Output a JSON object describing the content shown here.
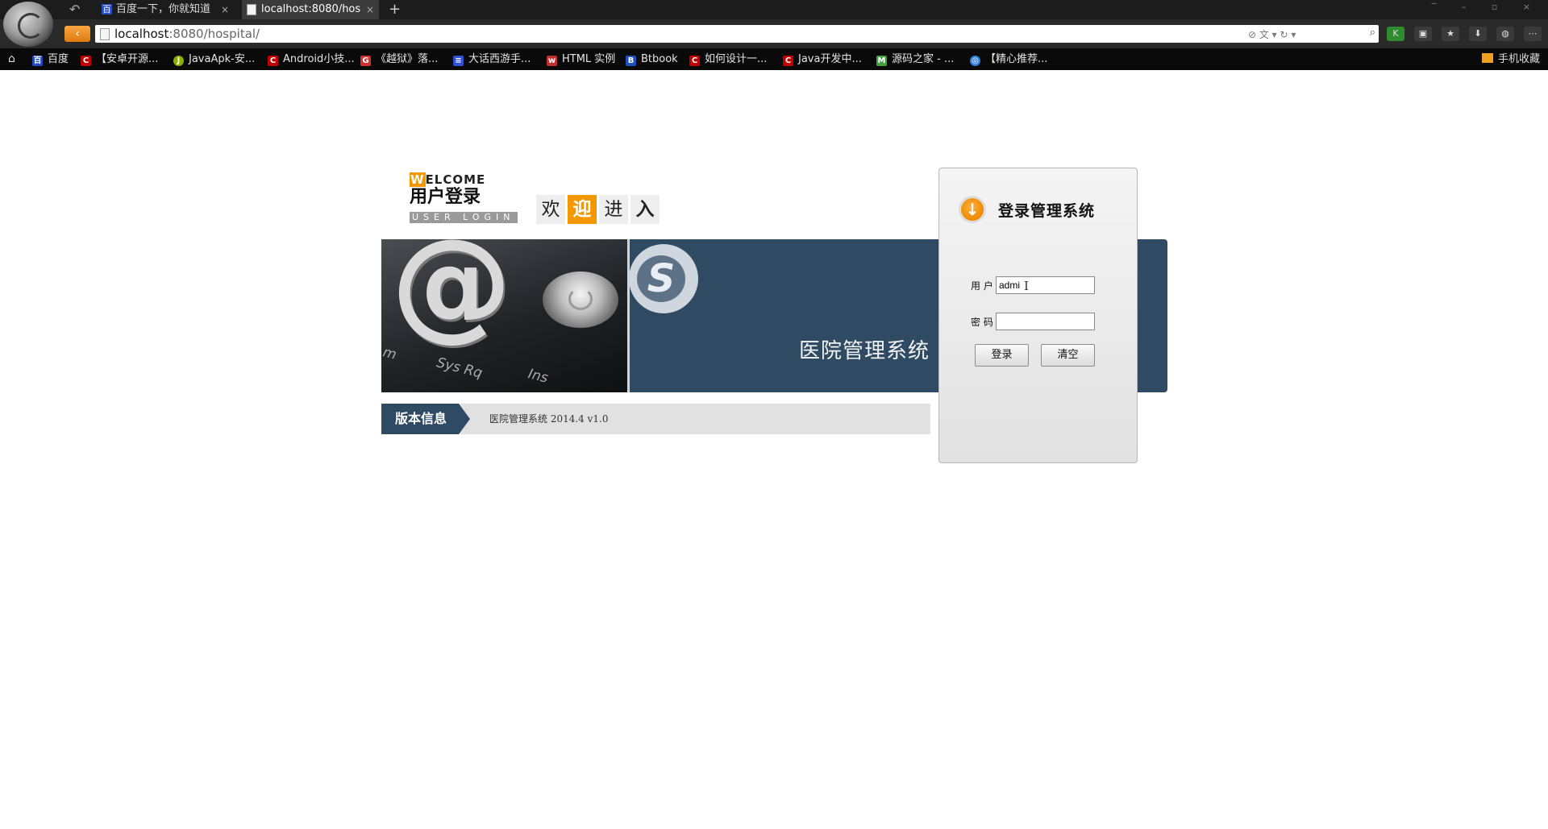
{
  "browser": {
    "tabs": [
      {
        "title": "百度一下，你就知道",
        "close": "×"
      },
      {
        "title": "localhost:8080/hos",
        "close": "×"
      }
    ],
    "new_tab": "+",
    "window_controls": "‾ – ▫ ×",
    "address": {
      "host": "localhost",
      "path": ":8080/hospital/"
    },
    "url_tools": "⊘ 文 ▾ ↻ ▾",
    "bookmarks": [
      {
        "label": "百度",
        "icon": "baidu-icon",
        "color": "#2448c0",
        "glyph": "百"
      },
      {
        "label": "【安卓开源...",
        "icon": "csdn-icon",
        "color": "#c00000",
        "glyph": "C"
      },
      {
        "label": "JavaApk-安...",
        "icon": "javaapk-icon",
        "color": "#8ab000",
        "glyph": "J"
      },
      {
        "label": "Android小技...",
        "icon": "csdn-icon",
        "color": "#c00000",
        "glyph": "C"
      },
      {
        "label": "《越狱》落...",
        "icon": "g-icon",
        "color": "#d03030",
        "glyph": "G"
      },
      {
        "label": "大话西游手...",
        "icon": "grid-icon",
        "color": "#3050d0",
        "glyph": "≡"
      },
      {
        "label": "HTML 实例",
        "icon": "w3-icon",
        "color": "#c03030",
        "glyph": "w"
      },
      {
        "label": "Btbook",
        "icon": "btbook-icon",
        "color": "#2050c0",
        "glyph": "B"
      },
      {
        "label": "如何设计一...",
        "icon": "csdn-icon",
        "color": "#c00000",
        "glyph": "C"
      },
      {
        "label": "Java开发中...",
        "icon": "csdn-icon",
        "color": "#c00000",
        "glyph": "C"
      },
      {
        "label": "源码之家 - ...",
        "icon": "m-icon",
        "color": "#40a040",
        "glyph": "M"
      },
      {
        "label": "【精心推荐...",
        "icon": "globe-icon",
        "color": "#3080e0",
        "glyph": "◎"
      }
    ],
    "mobile_bookmarks": "手机收藏"
  },
  "page": {
    "welcome_en": "WELCOME",
    "welcome_first_letter": "W",
    "welcome_rest": "ELCOME",
    "user_login_cn": "用户登录",
    "user_login_en": "USER LOGIN",
    "huanying": [
      "欢",
      "迎",
      "进",
      "入"
    ],
    "banner_title": "医院管理系统",
    "banner_keys": [
      "Sys Rq",
      "Ins",
      "m"
    ],
    "version_tab": "版本信息",
    "version_text": "医院管理系统 2014.4 v1.0",
    "accent_color": "#f39800",
    "banner_color": "#2f4a63"
  },
  "login": {
    "title": "登录管理系统",
    "user_label": "用 户",
    "user_value": "admi",
    "pwd_label": "密 码",
    "pwd_value": "",
    "login_button": "登录",
    "clear_button": "清空"
  }
}
